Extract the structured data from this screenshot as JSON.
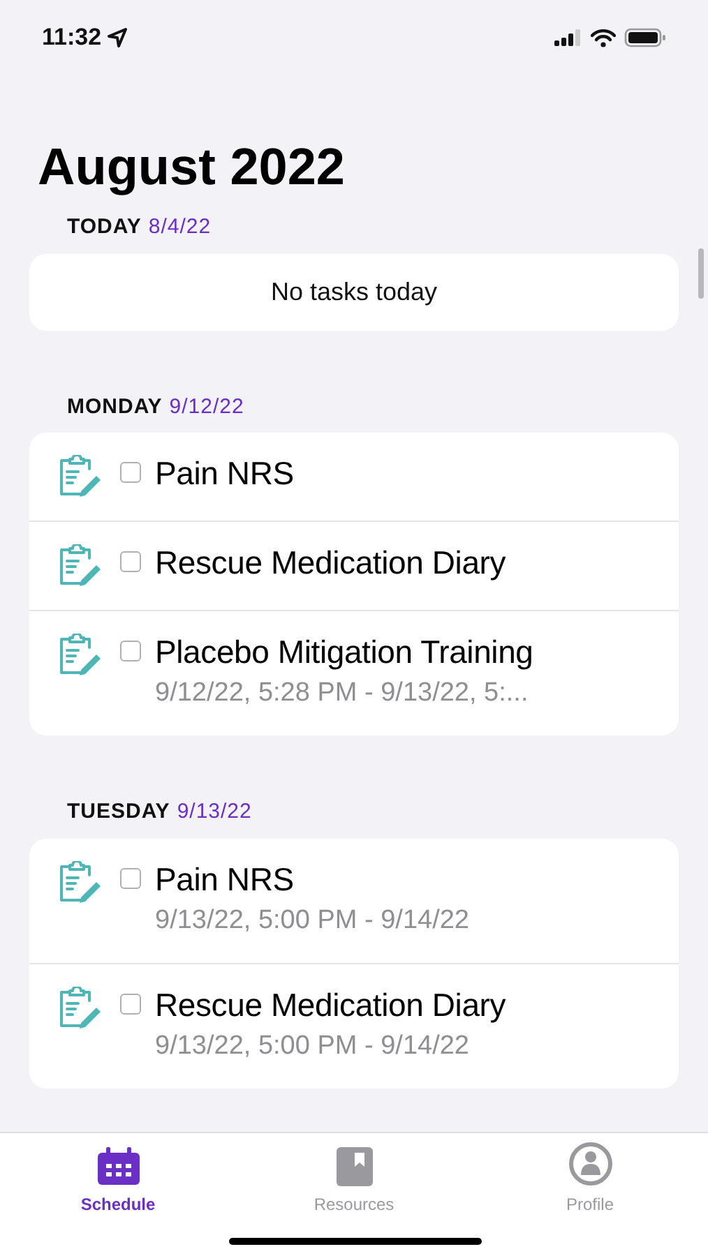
{
  "status_bar": {
    "time": "11:32"
  },
  "title": "August 2022",
  "sections": [
    {
      "day": "TODAY",
      "date": "8/4/22",
      "empty_text": "No tasks today"
    },
    {
      "day": "MONDAY",
      "date": "9/12/22",
      "tasks": [
        {
          "title": "Pain NRS",
          "checked": false
        },
        {
          "title": "Rescue Medication Diary",
          "checked": false
        },
        {
          "title": "Placebo Mitigation Training",
          "subtitle": "9/12/22, 5:28 PM - 9/13/22, 5:...",
          "checked": false
        }
      ]
    },
    {
      "day": "TUESDAY",
      "date": "9/13/22",
      "tasks": [
        {
          "title": "Pain NRS",
          "subtitle": "9/13/22, 5:00 PM - 9/14/22",
          "checked": false
        },
        {
          "title": "Rescue Medication Diary",
          "subtitle": "9/13/22, 5:00 PM - 9/14/22",
          "checked": false
        }
      ]
    }
  ],
  "tabs": [
    {
      "kind": "schedule",
      "label": "Schedule",
      "selected": true
    },
    {
      "kind": "resources",
      "label": "Resources",
      "selected": false
    },
    {
      "kind": "profile",
      "label": "Profile",
      "selected": false
    }
  ]
}
